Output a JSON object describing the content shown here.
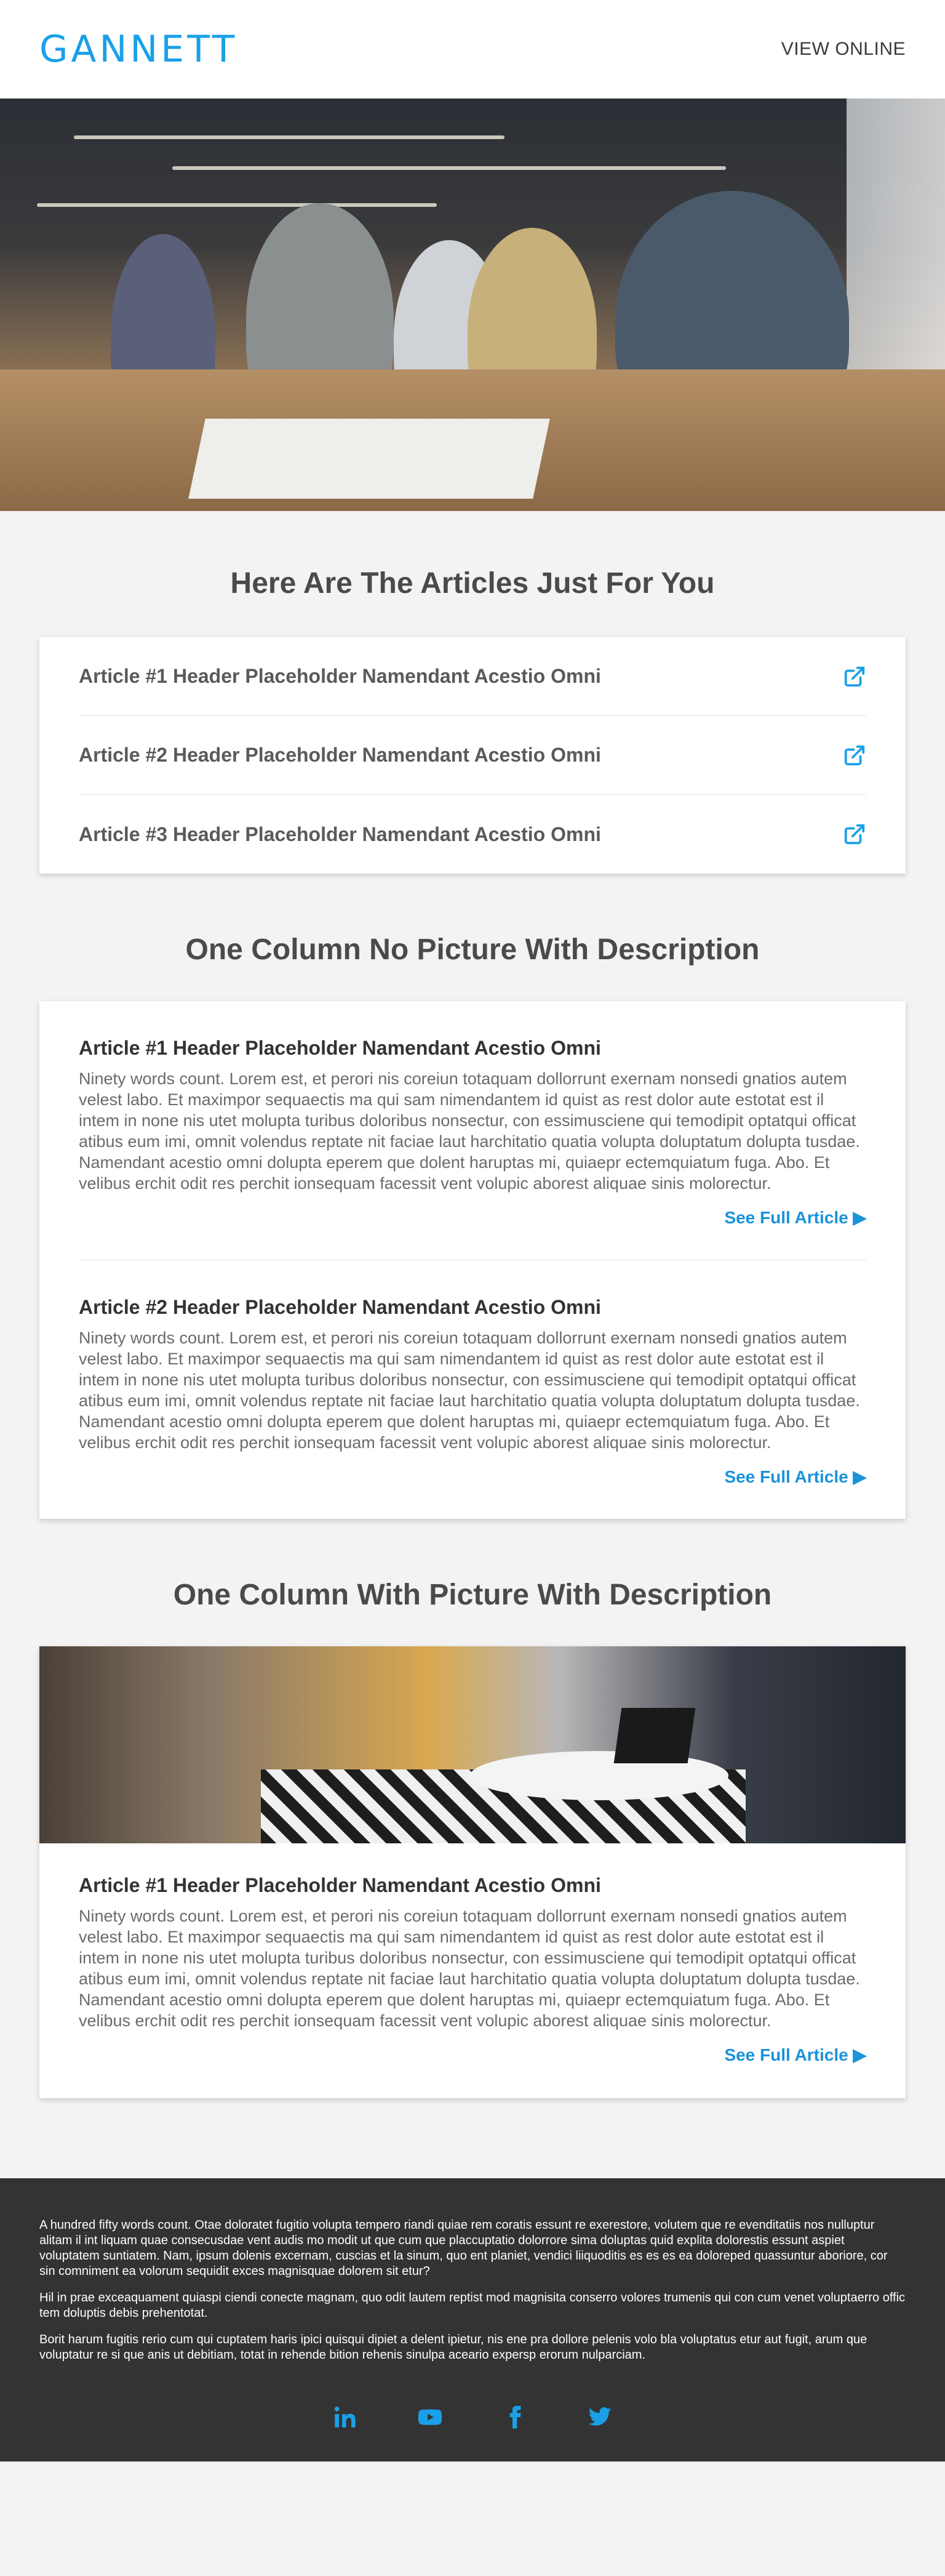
{
  "header": {
    "logo": "GANNETT",
    "view_online": "VIEW ONLINE"
  },
  "hero": {
    "alt": "Team collaborating around a table"
  },
  "articles_section": {
    "title": "Here Are The Articles Just For You",
    "items": [
      {
        "title": "Article #1 Header Placeholder Namendant Acestio Omni",
        "icon": "external-link-icon"
      },
      {
        "title": "Article #2 Header Placeholder Namendant Acestio Omni",
        "icon": "external-link-icon"
      },
      {
        "title": "Article #3 Header Placeholder Namendant Acestio Omni",
        "icon": "external-link-icon"
      }
    ]
  },
  "no_picture_section": {
    "title": "One Column No Picture With Description",
    "items": [
      {
        "title": "Article #1 Header Placeholder Namendant Acestio Omni",
        "description": "Ninety words count. Lorem est, et perori nis coreiun totaquam dollorrunt exernam nonsedi gnatios autem velest labo. Et maximpor sequaectis ma qui sam nimendantem id quist as rest dolor aute estotat est il intem in none nis utet molupta turibus doloribus nonsectur, con essimusciene qui temodipit optatqui officat atibus eum imi, omnit volendus reptate nit faciae laut harchitatio quatia volupta doluptatum dolupta tusdae. Namendant acestio omni dolupta eperem que dolent haruptas mi, quiaepr ectemquiatum fuga. Abo. Et velibus erchit odit res perchit ionsequam facessit vent volupic aborest aliquae sinis molorectur.",
        "link": "See Full Article ▶"
      },
      {
        "title": "Article #2 Header Placeholder Namendant Acestio Omni",
        "description": "Ninety words count. Lorem est, et perori nis coreiun totaquam dollorrunt exernam nonsedi gnatios autem velest labo. Et maximpor sequaectis ma qui sam nimendantem id quist as rest dolor aute estotat est il intem in none nis utet molupta turibus doloribus nonsectur, con essimusciene qui temodipit optatqui officat atibus eum imi, omnit volendus reptate nit faciae laut harchitatio quatia volupta doluptatum dolupta tusdae. Namendant acestio omni dolupta eperem que dolent haruptas mi, quiaepr ectemquiatum fuga. Abo. Et velibus erchit odit res perchit ionsequam facessit vent volupic aborest aliquae sinis molorectur.",
        "link": "See Full Article ▶"
      }
    ]
  },
  "picture_section": {
    "title": "One Column With Picture With Description",
    "item": {
      "title": "Article #1 Header Placeholder Namendant Acestio Omni",
      "description": "Ninety words count. Lorem est, et perori nis coreiun totaquam dollorrunt exernam nonsedi gnatios autem velest labo. Et maximpor sequaectis ma qui sam nimendantem id quist as rest dolor aute estotat est il intem in none nis utet molupta turibus doloribus nonsectur, con essimusciene qui temodipit optatqui officat atibus eum imi, omnit volendus reptate nit faciae laut harchitatio quatia volupta doluptatum dolupta tusdae. Namendant acestio omni dolupta eperem que dolent haruptas mi, quiaepr ectemquiatum fuga. Abo. Et velibus erchit odit res perchit ionsequam facessit vent volupic aborest aliquae sinis molorectur.",
      "link": "See Full Article ▶"
    }
  },
  "footer": {
    "paragraphs": [
      "A hundred fifty words count. Otae doloratet fugitio volupta tempero riandi quiae rem coratis essunt re exerestore, volutem que re evenditatiis nos nulluptur alitam il int liquam quae consecusdae vent audis mo modit ut que cum que placcuptatio dolorrore sima doluptas quid explita dolorestis essunt aspiet voluptatem suntiatem. Nam, ipsum dolenis excernam, cuscias et la sinum, quo ent planiet, vendici liiquoditis es es es ea doloreped quassuntur aboriore, cor sin comniment ea volorum sequidit exces magnisquae dolorem sit etur?",
      "Hil in prae exceaquament quiaspi ciendi conecte magnam, quo odit lautem reptist mod magnisita conserro volores trumenis qui con cum venet voluptaerro offic tem doluptis debis prehentotat.",
      "Borit harum fugitis rerio cum qui cuptatem haris ipici quisqui dipiet a delent ipietur, nis ene pra dollore pelenis volo bla voluptatus etur aut fugit, arum que voluptatur re si que anis ut debitiam, totat in rehende bition rehenis sinulpa aceario expersp erorum nulparciam."
    ],
    "social": [
      "linkedin-icon",
      "youtube-icon",
      "facebook-icon",
      "twitter-icon"
    ]
  },
  "colors": {
    "brand": "#1aa0e8",
    "link": "#1a93d9",
    "footer_bg": "#333333",
    "page_bg": "#f3f3f3"
  }
}
